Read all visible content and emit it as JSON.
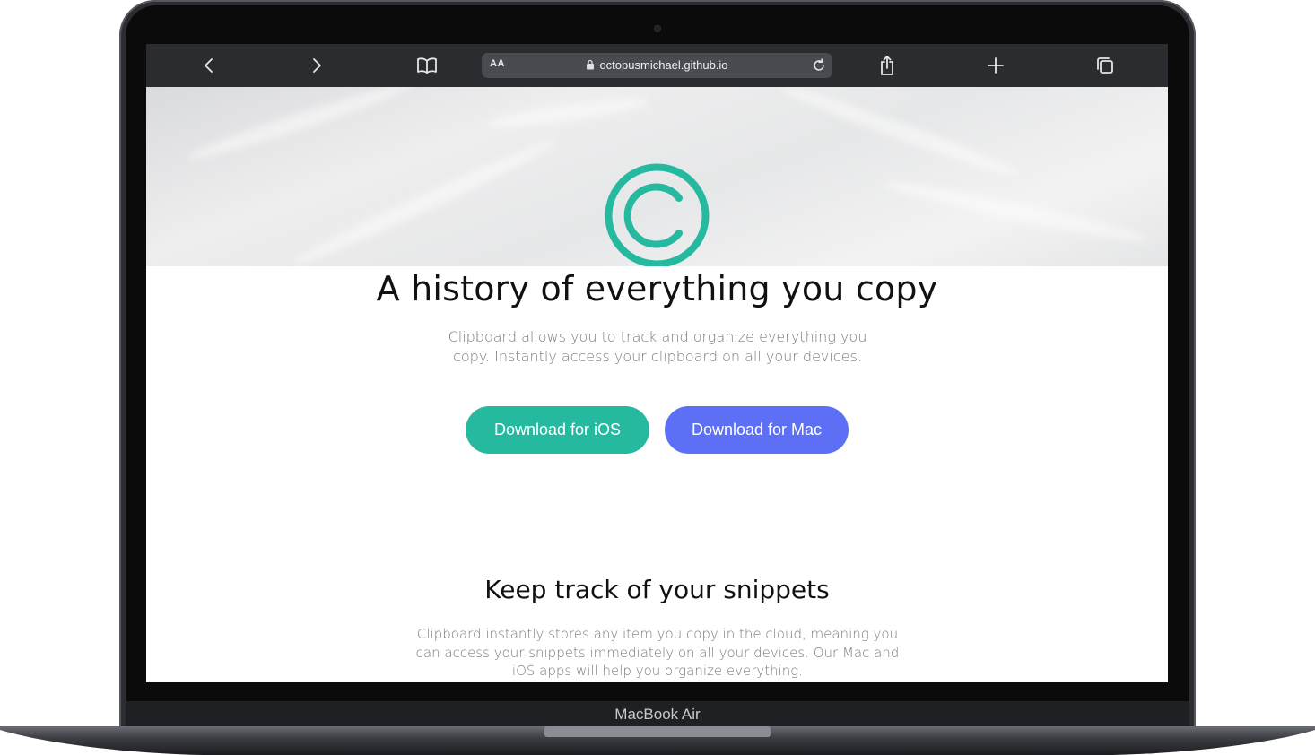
{
  "device": {
    "label": "MacBook Air"
  },
  "browser": {
    "reader_label": "AA",
    "url": "octopusmichael.github.io",
    "icons": [
      "back-icon",
      "forward-icon",
      "bookmarks-icon",
      "lock-icon",
      "reload-icon",
      "share-icon",
      "new-tab-icon",
      "tabs-icon"
    ]
  },
  "page": {
    "logo_icon": "copyright-icon",
    "headline": "A history of everything you copy",
    "subheadline": "Clipboard allows you to track and organize everything you copy. Instantly access your clipboard on all your devices.",
    "buttons": {
      "ios": "Download for iOS",
      "mac": "Download for Mac"
    },
    "section_title": "Keep track of your snippets",
    "section_text": "Clipboard instantly stores any item you copy in the cloud, meaning you can access your snippets immediately on all your devices. Our Mac and iOS apps will help you organize everything."
  },
  "colors": {
    "accent_teal": "#25b9a0",
    "accent_blue": "#5c6ff5",
    "toolbar": "#2a2c2f"
  }
}
